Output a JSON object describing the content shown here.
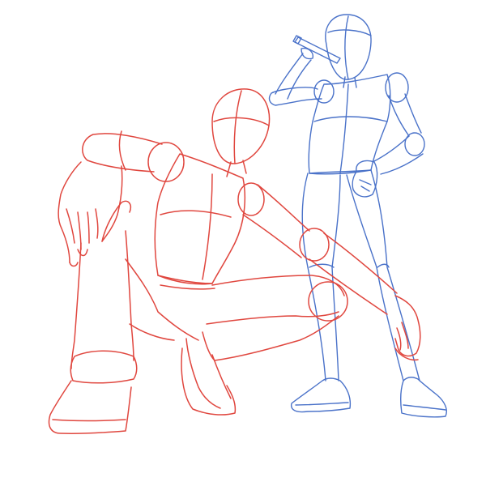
{
  "artwork": {
    "background_color": "#ffffff",
    "figures": [
      {
        "id": "crouching-figure",
        "stroke_color": "#e0473f"
      },
      {
        "id": "standing-figure",
        "stroke_color": "#4a72c9"
      }
    ]
  }
}
